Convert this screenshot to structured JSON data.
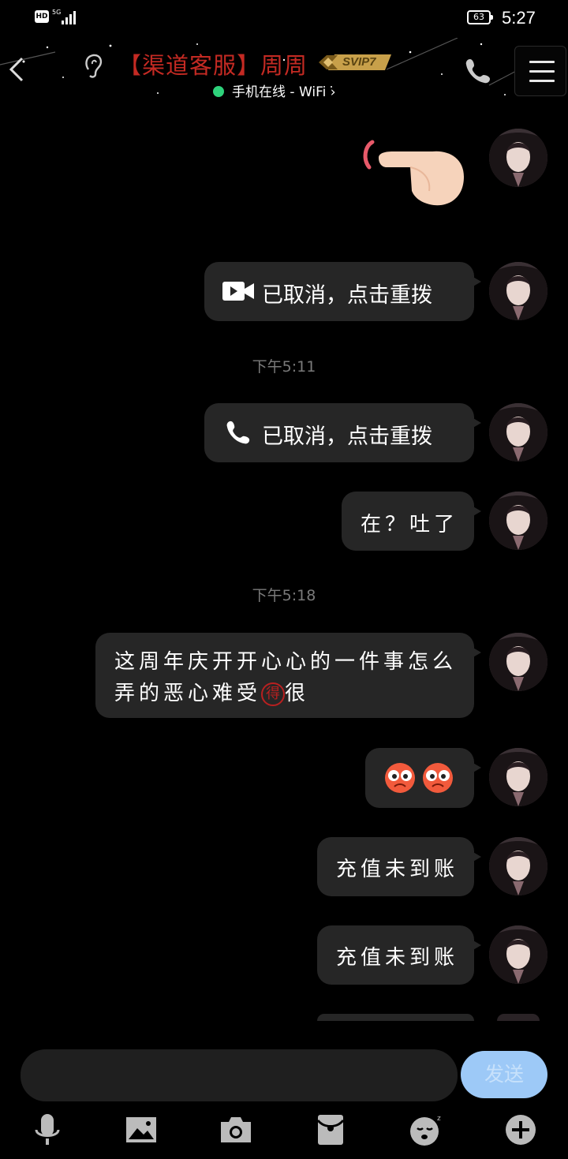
{
  "status_bar": {
    "hd": "HD",
    "network": "5G",
    "battery": "63",
    "time": "5:27"
  },
  "header": {
    "title": "【渠道客服】周周",
    "vip_badge": "SVIP7",
    "online_status": "手机在线 - WiFi",
    "online_chevron": "›"
  },
  "messages": [
    {
      "type": "poke"
    },
    {
      "type": "call",
      "icon": "video-call-icon",
      "text": "已取消，点击重拨"
    },
    {
      "type": "time",
      "text": "下午5:11"
    },
    {
      "type": "call",
      "icon": "phone-call-icon",
      "text": "已取消，点击重拨"
    },
    {
      "type": "text",
      "text": "在？吐了"
    },
    {
      "type": "time",
      "text": "下午5:18"
    },
    {
      "type": "text",
      "line1": "这周年庆开开心心的一件事怎么",
      "line2a": "弄的恶心难受",
      "line2_badge": "得",
      "line2b": "很"
    },
    {
      "type": "emoji",
      "icons": [
        "worried-face-icon",
        "worried-face-icon"
      ]
    },
    {
      "type": "text",
      "text": "充值未到账"
    },
    {
      "type": "text",
      "text": "充值未到账"
    }
  ],
  "input": {
    "placeholder": "",
    "send_label": "发送"
  },
  "toolbar": [
    "voice-icon",
    "image-icon",
    "camera-icon",
    "red-packet-icon",
    "sticker-icon",
    "plus-icon"
  ],
  "colors": {
    "title": "#c42a23",
    "online": "#2ed27b",
    "send_button": "#9dc9f7",
    "bubble": "#262626"
  }
}
